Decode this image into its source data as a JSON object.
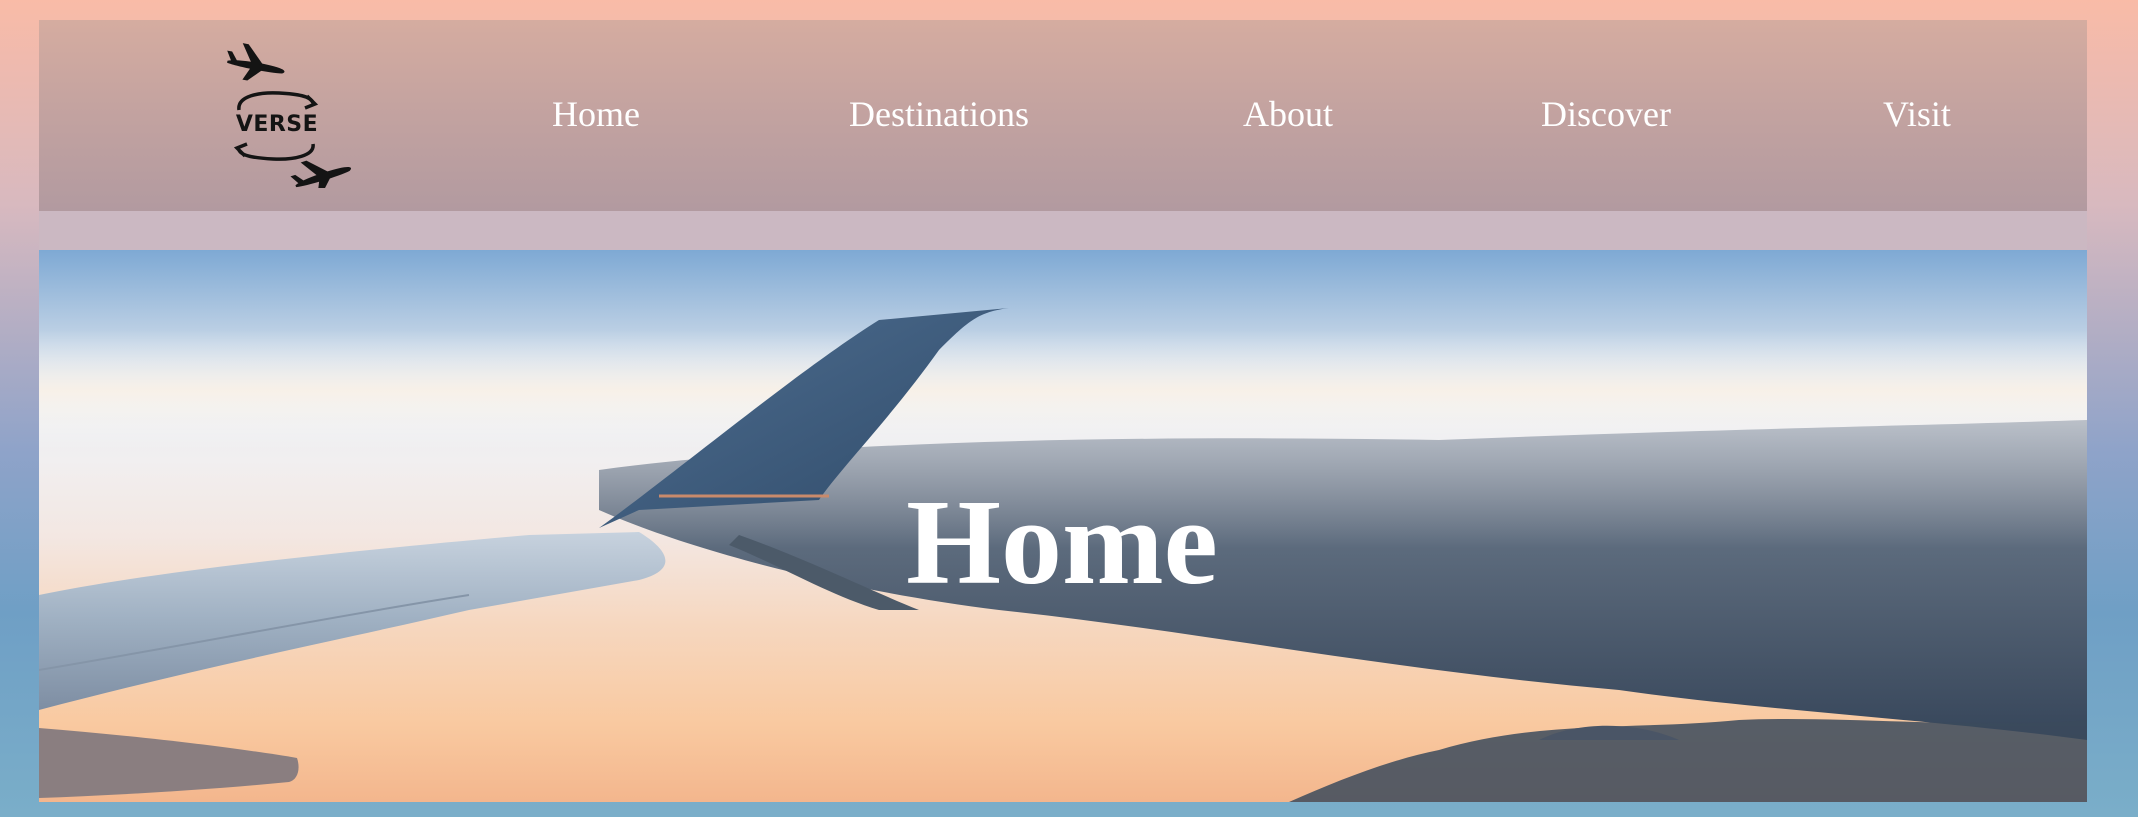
{
  "logo": {
    "text": "VERSE",
    "icon": "airplane-exchange-logo"
  },
  "nav": {
    "items": [
      {
        "label": "Home"
      },
      {
        "label": "Destinations"
      },
      {
        "label": "About"
      },
      {
        "label": "Discover"
      },
      {
        "label": "Visit"
      }
    ]
  },
  "hero": {
    "title": "Home",
    "image": "airplane-wing-over-clouds-at-sunset"
  },
  "colors": {
    "page_gradient_top": "#f9bba7",
    "page_gradient_bottom": "#7aaec9",
    "nav_background": "#c4a3a0",
    "nav_text": "#ffffff",
    "hero_title": "#ffffff"
  }
}
